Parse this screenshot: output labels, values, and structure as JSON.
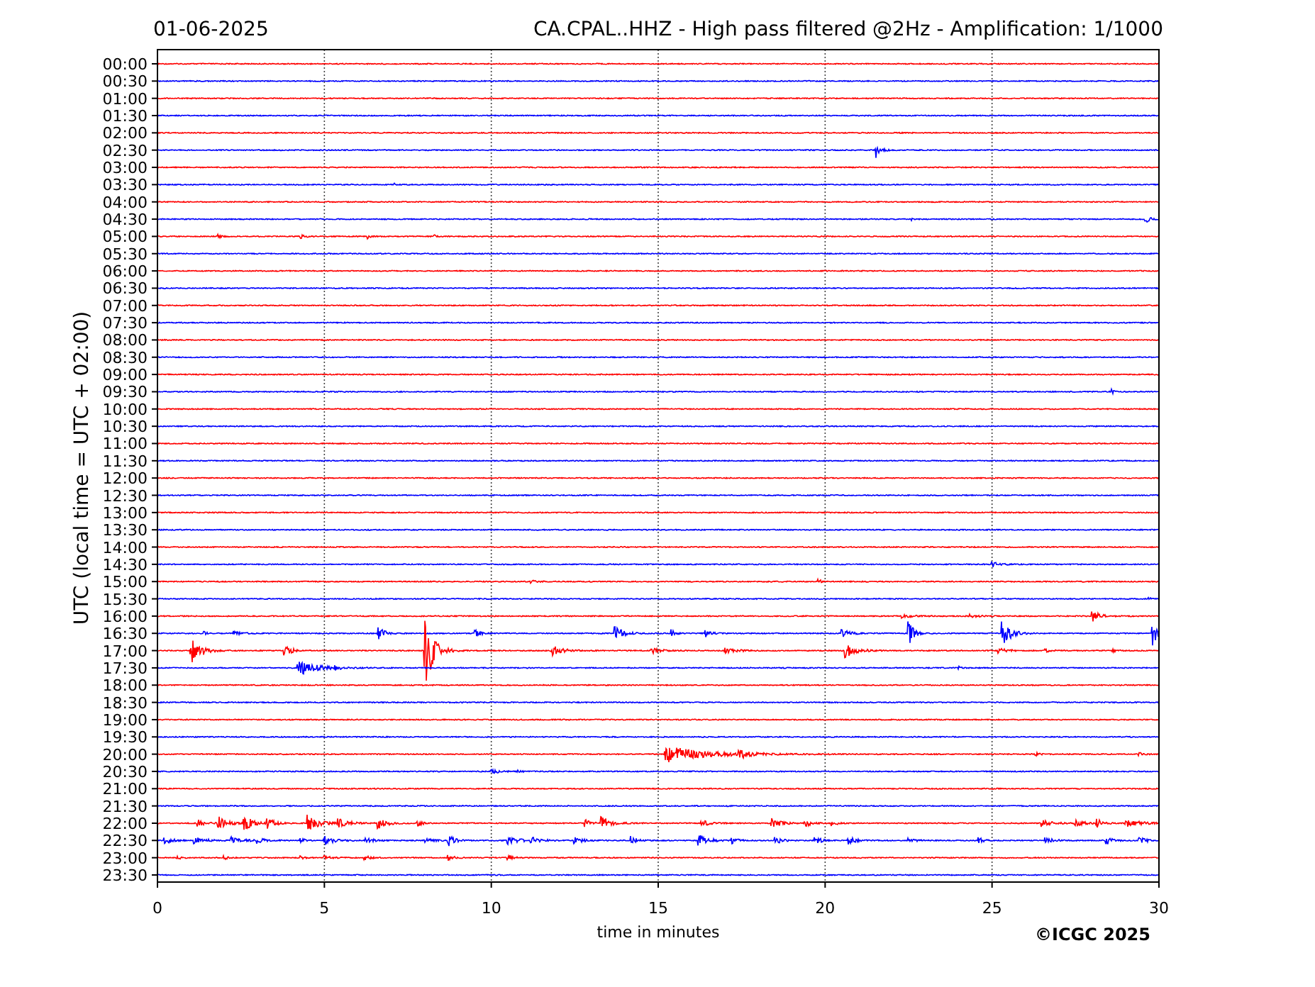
{
  "header": {
    "date": "01-06-2025",
    "title": "CA.CPAL..HHZ - High pass filtered @2Hz - Amplification: 1/1000"
  },
  "plot": {
    "ylabel": "UTC (local time = UTC + 02:00)",
    "xlabel": "time in minutes",
    "xticks": [
      "0",
      "5",
      "10",
      "15",
      "20",
      "25",
      "30"
    ],
    "rows": [
      {
        "label": "00:00",
        "color": "#ff0000"
      },
      {
        "label": "00:30",
        "color": "#0000ff"
      },
      {
        "label": "01:00",
        "color": "#ff0000"
      },
      {
        "label": "01:30",
        "color": "#0000ff"
      },
      {
        "label": "02:00",
        "color": "#ff0000"
      },
      {
        "label": "02:30",
        "color": "#0000ff"
      },
      {
        "label": "03:00",
        "color": "#ff0000"
      },
      {
        "label": "03:30",
        "color": "#0000ff"
      },
      {
        "label": "04:00",
        "color": "#ff0000"
      },
      {
        "label": "04:30",
        "color": "#0000ff"
      },
      {
        "label": "05:00",
        "color": "#ff0000"
      },
      {
        "label": "05:30",
        "color": "#0000ff"
      },
      {
        "label": "06:00",
        "color": "#ff0000"
      },
      {
        "label": "06:30",
        "color": "#0000ff"
      },
      {
        "label": "07:00",
        "color": "#ff0000"
      },
      {
        "label": "07:30",
        "color": "#0000ff"
      },
      {
        "label": "08:00",
        "color": "#ff0000"
      },
      {
        "label": "08:30",
        "color": "#0000ff"
      },
      {
        "label": "09:00",
        "color": "#ff0000"
      },
      {
        "label": "09:30",
        "color": "#0000ff"
      },
      {
        "label": "10:00",
        "color": "#ff0000"
      },
      {
        "label": "10:30",
        "color": "#0000ff"
      },
      {
        "label": "11:00",
        "color": "#ff0000"
      },
      {
        "label": "11:30",
        "color": "#0000ff"
      },
      {
        "label": "12:00",
        "color": "#ff0000"
      },
      {
        "label": "12:30",
        "color": "#0000ff"
      },
      {
        "label": "13:00",
        "color": "#ff0000"
      },
      {
        "label": "13:30",
        "color": "#0000ff"
      },
      {
        "label": "14:00",
        "color": "#ff0000"
      },
      {
        "label": "14:30",
        "color": "#0000ff"
      },
      {
        "label": "15:00",
        "color": "#ff0000"
      },
      {
        "label": "15:30",
        "color": "#0000ff"
      },
      {
        "label": "16:00",
        "color": "#ff0000"
      },
      {
        "label": "16:30",
        "color": "#0000ff"
      },
      {
        "label": "17:00",
        "color": "#ff0000"
      },
      {
        "label": "17:30",
        "color": "#0000ff"
      },
      {
        "label": "18:00",
        "color": "#ff0000"
      },
      {
        "label": "18:30",
        "color": "#0000ff"
      },
      {
        "label": "19:00",
        "color": "#ff0000"
      },
      {
        "label": "19:30",
        "color": "#0000ff"
      },
      {
        "label": "20:00",
        "color": "#ff0000"
      },
      {
        "label": "20:30",
        "color": "#0000ff"
      },
      {
        "label": "21:00",
        "color": "#ff0000"
      },
      {
        "label": "21:30",
        "color": "#0000ff"
      },
      {
        "label": "22:00",
        "color": "#ff0000"
      },
      {
        "label": "22:30",
        "color": "#0000ff"
      },
      {
        "label": "23:00",
        "color": "#ff0000"
      },
      {
        "label": "23:30",
        "color": "#0000ff"
      }
    ]
  },
  "copyright": "©ICGC 2025"
}
